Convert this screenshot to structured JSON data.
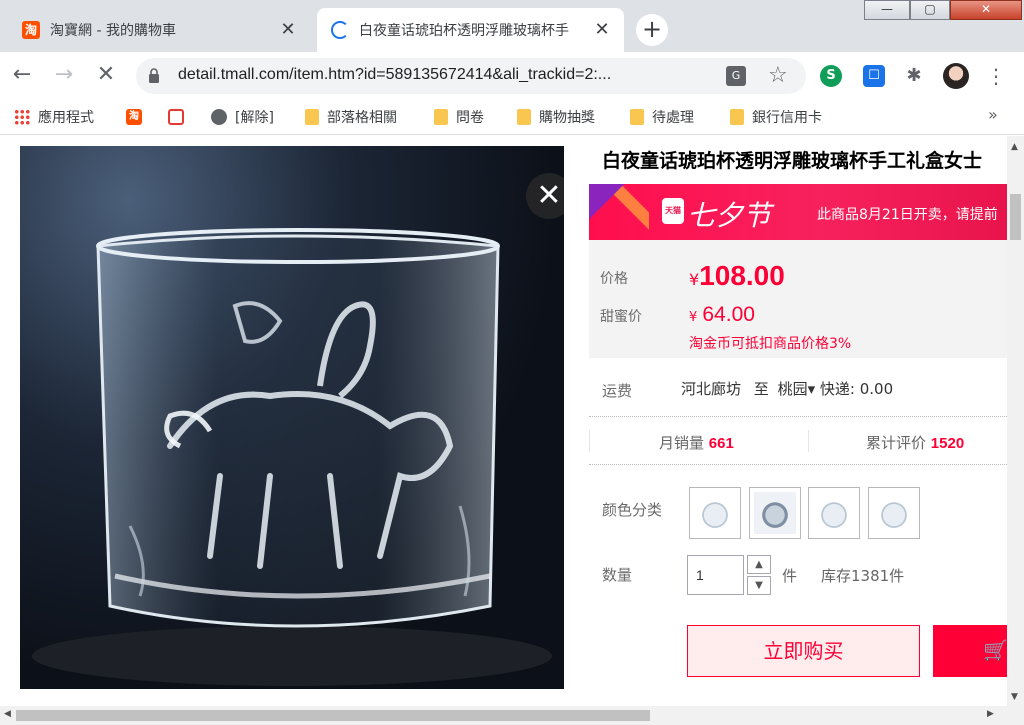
{
  "browser": {
    "tabs": [
      {
        "title": "淘寶網 - 我的購物車",
        "favicon": "taobao-icon",
        "active": false
      },
      {
        "title": "白夜童话琥珀杯透明浮雕玻璃杯手",
        "favicon": "loading-spinner-icon",
        "active": true
      }
    ],
    "new_tab": "+",
    "window_buttons": {
      "minimize": "—",
      "maximize": "▢",
      "close": "✕"
    },
    "url": "detail.tmall.com/item.htm?id=589135672414&ali_trackid=2:...",
    "extensions": [
      "S",
      "☐",
      "✱"
    ],
    "bookmarks": [
      {
        "label": "應用程式",
        "icon": "apps-grid-icon"
      },
      {
        "label": "",
        "icon": "taobao-icon"
      },
      {
        "label": "",
        "icon": "image-search-icon"
      },
      {
        "label": "[解除]",
        "icon": "globe-icon"
      },
      {
        "label": "部落格相關",
        "icon": "folder-icon"
      },
      {
        "label": "問卷",
        "icon": "folder-icon"
      },
      {
        "label": "購物抽獎",
        "icon": "folder-icon"
      },
      {
        "label": "待處理",
        "icon": "folder-icon"
      },
      {
        "label": "銀行信用卡",
        "icon": "folder-icon"
      }
    ],
    "bookmarks_more": "»"
  },
  "product": {
    "title": "白夜童话琥珀杯透明浮雕玻璃杯手工礼盒女士",
    "image_close": "✕",
    "promo": {
      "badge": "天猫",
      "festival": "七夕节",
      "notice": "此商品8月21日开卖，请提前"
    },
    "price": {
      "label": "价格",
      "currency": "¥",
      "value": "108.00"
    },
    "sweet_price": {
      "label": "甜蜜价",
      "currency": "¥",
      "value": "64.00"
    },
    "coin_note": "淘金币可抵扣商品价格3%",
    "shipping": {
      "label": "运费",
      "from": "河北廊坊",
      "to_word": "至",
      "to": "桃园",
      "method": "快递: 0.00"
    },
    "stats": {
      "monthly_sales_label": "月销量",
      "monthly_sales": "661",
      "reviews_label": "累计评价",
      "reviews": "1520"
    },
    "color_label": "颜色分类",
    "quantity": {
      "label": "数量",
      "value": "1",
      "unit": "件",
      "stock": "库存1381件"
    },
    "buy_now": "立即购买",
    "add_cart_icon": "🛒"
  },
  "colors": {
    "accent": "#ff0036",
    "promo": "#f7215d"
  }
}
